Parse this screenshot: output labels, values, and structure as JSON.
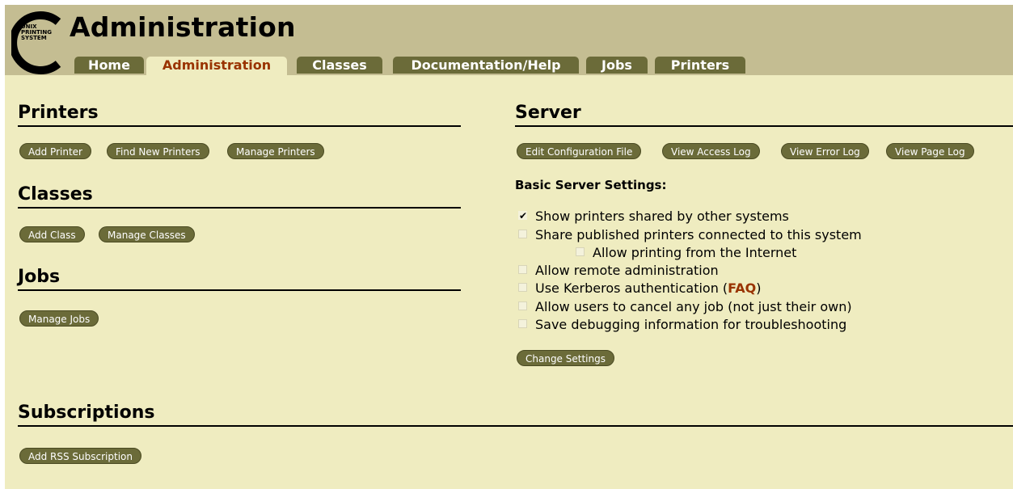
{
  "logo": {
    "text_lines": [
      "UNIX",
      "PRINTING",
      "SYSTEM"
    ]
  },
  "page_title": "Administration",
  "tabs": [
    {
      "label": "Home",
      "active": false
    },
    {
      "label": "Administration",
      "active": true
    },
    {
      "label": "Classes",
      "active": false
    },
    {
      "label": "Documentation/Help",
      "active": false
    },
    {
      "label": "Jobs",
      "active": false
    },
    {
      "label": "Printers",
      "active": false
    }
  ],
  "printers": {
    "title": "Printers",
    "buttons": [
      "Add Printer",
      "Find New Printers",
      "Manage Printers"
    ]
  },
  "classes": {
    "title": "Classes",
    "buttons": [
      "Add Class",
      "Manage Classes"
    ]
  },
  "jobs": {
    "title": "Jobs",
    "buttons": [
      "Manage Jobs"
    ]
  },
  "server": {
    "title": "Server",
    "buttons": [
      "Edit Configuration File",
      "View Access Log",
      "View Error Log",
      "View Page Log"
    ],
    "settings_heading": "Basic Server Settings:",
    "options": [
      {
        "label": "Show printers shared by other systems",
        "checked": true
      },
      {
        "label": "Share published printers connected to this system",
        "checked": false
      },
      {
        "label": "Allow printing from the Internet",
        "checked": false
      },
      {
        "label": "Allow remote administration",
        "checked": false
      },
      {
        "label": "Use Kerberos authentication (",
        "link": "FAQ",
        "suffix": ")",
        "checked": false
      },
      {
        "label": "Allow users to cancel any job (not just their own)",
        "checked": false
      },
      {
        "label": "Save debugging information for troubleshooting",
        "checked": false
      }
    ],
    "change_button": "Change Settings"
  },
  "subscriptions": {
    "title": "Subscriptions",
    "buttons": [
      "Add RSS Subscription"
    ]
  },
  "colors": {
    "header_bg": "#c4bd92",
    "content_bg": "#efecc0",
    "button_bg": "#6b6b39",
    "active_tab_text": "#993300"
  }
}
